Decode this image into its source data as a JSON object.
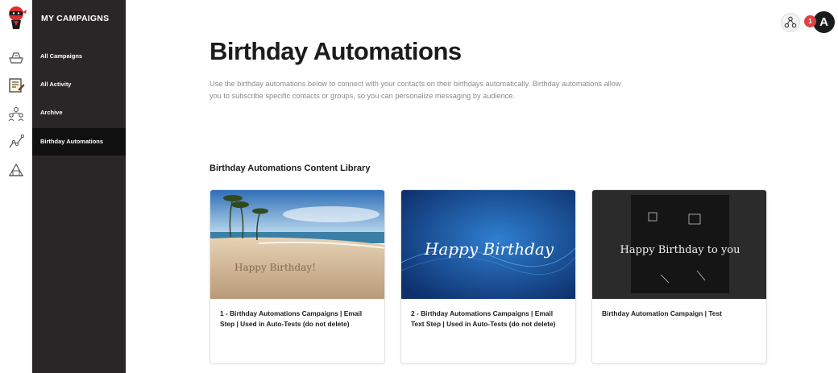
{
  "sidebar": {
    "title": "MY CAMPAIGNS",
    "items": [
      {
        "label": "All Campaigns"
      },
      {
        "label": "All Activity"
      },
      {
        "label": "Archive"
      },
      {
        "label": "Birthday Automations"
      }
    ]
  },
  "header": {
    "notification_count": "1",
    "avatar_letter": "A"
  },
  "main": {
    "title": "Birthday Automations",
    "description": "Use the birthday automations below to connect with your contacts on their birthdays automatically. Birthday automations allow you to subscribe specific contacts or groups, so you can personalize messaging by audience.",
    "section_title": "Birthday Automations Content Library",
    "cards": [
      {
        "title": "1 - Birthday Automations Campaigns | Email Step | Used in Auto-Tests (do not delete)",
        "image_text": "Happy Birthday!"
      },
      {
        "title": "2 - Birthday Automations Campaigns | Email Text Step | Used in Auto-Tests (do not delete)",
        "image_text": "Happy Birthday"
      },
      {
        "title": "Birthday Automation Campaign | Test",
        "image_text": "Happy Birthday to you"
      }
    ]
  },
  "colors": {
    "sidebar_bg": "#2a2527",
    "sidebar_active": "#111011",
    "badge": "#e0413f",
    "accent_red": "#d9302c"
  },
  "icons": [
    "ninja-logo-icon",
    "campaigns-icon",
    "automations-icon",
    "contacts-icon",
    "analytics-icon",
    "templates-icon",
    "org-chart-icon"
  ]
}
